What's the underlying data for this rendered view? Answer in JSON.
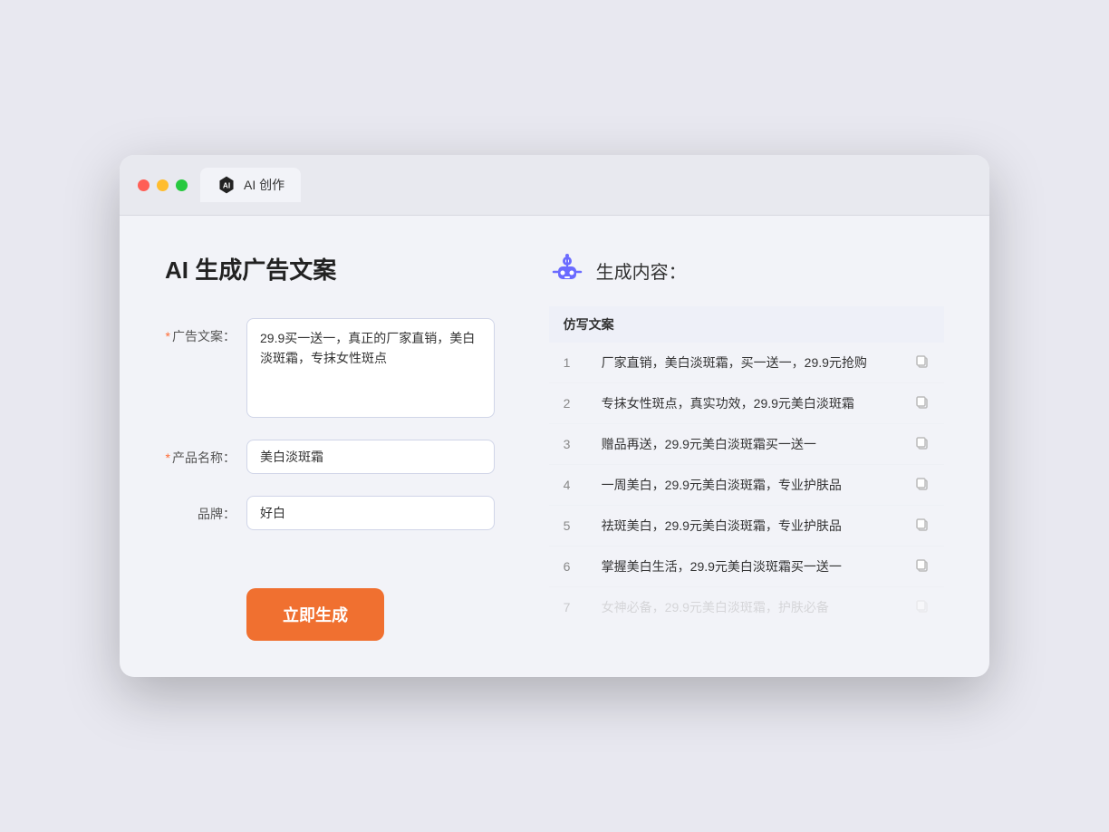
{
  "browser": {
    "tab_label": "AI 创作"
  },
  "page": {
    "title": "AI 生成广告文案",
    "result_title": "生成内容："
  },
  "form": {
    "ad_copy_label": "广告文案：",
    "ad_copy_required": true,
    "ad_copy_value": "29.9买一送一，真正的厂家直销，美白淡斑霜，专抹女性斑点",
    "product_name_label": "产品名称：",
    "product_name_required": true,
    "product_name_value": "美白淡斑霜",
    "brand_label": "品牌：",
    "brand_required": false,
    "brand_value": "好白",
    "generate_button": "立即生成"
  },
  "results": {
    "column_header": "仿写文案",
    "items": [
      {
        "num": 1,
        "text": "厂家直销，美白淡斑霜，买一送一，29.9元抢购",
        "muted": false
      },
      {
        "num": 2,
        "text": "专抹女性斑点，真实功效，29.9元美白淡斑霜",
        "muted": false
      },
      {
        "num": 3,
        "text": "赠品再送，29.9元美白淡斑霜买一送一",
        "muted": false
      },
      {
        "num": 4,
        "text": "一周美白，29.9元美白淡斑霜，专业护肤品",
        "muted": false
      },
      {
        "num": 5,
        "text": "祛斑美白，29.9元美白淡斑霜，专业护肤品",
        "muted": false
      },
      {
        "num": 6,
        "text": "掌握美白生活，29.9元美白淡斑霜买一送一",
        "muted": false
      },
      {
        "num": 7,
        "text": "女神必备，29.9元美白淡斑霜，护肤必备",
        "muted": true
      }
    ]
  }
}
